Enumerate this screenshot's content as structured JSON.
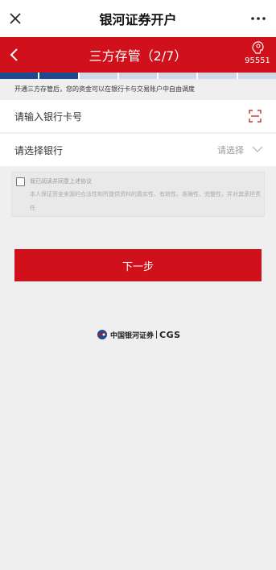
{
  "topbar": {
    "title": "银河证券开户"
  },
  "header": {
    "title": "三方存管（2/7）",
    "service_number": "95551"
  },
  "progress": {
    "total_steps": 7,
    "current_step": 2,
    "active_color": "#1e4b8f",
    "inactive_color": "#cdd7e8"
  },
  "notice": "开通三方存管后，您的资金可以在银行卡与交易账户中自由调度",
  "form": {
    "card_label": "请输入银行卡号",
    "bank_label": "请选择银行",
    "bank_placeholder": "请选择"
  },
  "agreement": {
    "checkbox_label": "我已阅读并同意上述协议",
    "statement": "本人保证资金来源的合法性和所提供资料的真实性、有效性、准确性、完整性，并对其承担责任"
  },
  "next_button": "下一步",
  "footer": {
    "logo_cn": "中国银河证券",
    "logo_en": "CGS"
  },
  "colors": {
    "brand_red": "#d0111b",
    "brand_blue": "#1e4b8f"
  }
}
